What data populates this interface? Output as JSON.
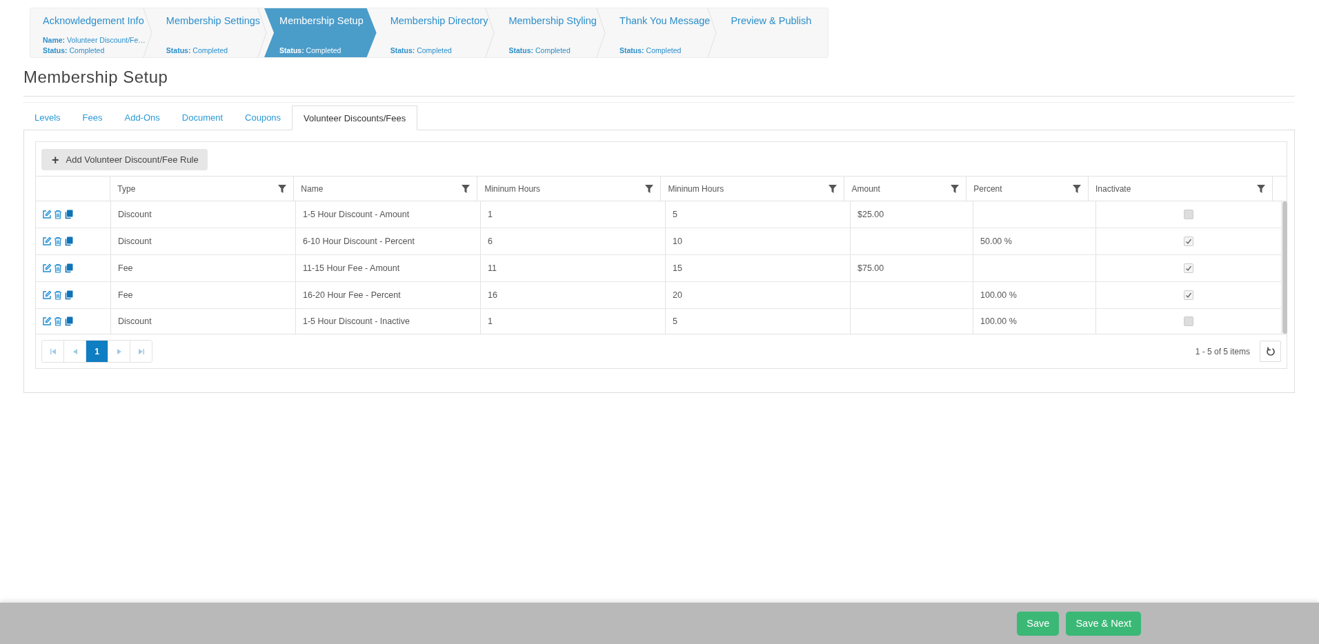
{
  "wizard": {
    "steps": [
      {
        "title": "Acknowledgement Info",
        "name_label": "Name:",
        "name": "Volunteer Discount/Fe…",
        "status_label": "Status:",
        "status": "Completed",
        "selected": false
      },
      {
        "title": "Membership Settings",
        "status_label": "Status:",
        "status": "Completed",
        "selected": false
      },
      {
        "title": "Membership Setup",
        "status_label": "Status:",
        "status": "Completed",
        "selected": true
      },
      {
        "title": "Membership Directory",
        "status_label": "Status:",
        "status": "Completed",
        "selected": false
      },
      {
        "title": "Membership Styling",
        "status_label": "Status:",
        "status": "Completed",
        "selected": false
      },
      {
        "title": "Thank You Message",
        "status_label": "Status:",
        "status": "Completed",
        "selected": false
      },
      {
        "title": "Preview & Publish",
        "selected": false
      }
    ]
  },
  "page_title": "Membership Setup",
  "tabs": [
    {
      "label": "Levels",
      "selected": false
    },
    {
      "label": "Fees",
      "selected": false
    },
    {
      "label": "Add-Ons",
      "selected": false
    },
    {
      "label": "Document",
      "selected": false
    },
    {
      "label": "Coupons",
      "selected": false
    },
    {
      "label": "Volunteer Discounts/Fees",
      "selected": true
    }
  ],
  "add_button": {
    "icon": "+",
    "label": "Add Volunteer Discount/Fee Rule"
  },
  "table": {
    "columns": [
      "Type",
      "Name",
      "Mininum Hours",
      "Mininum Hours",
      "Amount",
      "Percent",
      "Inactivate"
    ],
    "rows": [
      {
        "type": "Discount",
        "name": "1-5 Hour Discount - Amount",
        "min_hours": "1",
        "max_hours": "5",
        "amount": "$25.00",
        "percent": "",
        "inactive": false
      },
      {
        "type": "Discount",
        "name": "6-10 Hour Discount - Percent",
        "min_hours": "6",
        "max_hours": "10",
        "amount": "",
        "percent": "50.00 %",
        "inactive": true
      },
      {
        "type": "Fee",
        "name": "11-15 Hour Fee - Amount",
        "min_hours": "11",
        "max_hours": "15",
        "amount": "$75.00",
        "percent": "",
        "inactive": true
      },
      {
        "type": "Fee",
        "name": "16-20 Hour Fee - Percent",
        "min_hours": "16",
        "max_hours": "20",
        "amount": "",
        "percent": "100.00 %",
        "inactive": true
      },
      {
        "type": "Discount",
        "name": "1-5 Hour Discount - Inactive",
        "min_hours": "1",
        "max_hours": "5",
        "amount": "",
        "percent": "100.00 %",
        "inactive": false
      }
    ]
  },
  "pager": {
    "pages": [
      {
        "label": "1",
        "selected": true
      }
    ],
    "summary": "1 - 5 of 5 items"
  },
  "footer": {
    "buttons": [
      "Save",
      "Save & Next"
    ]
  }
}
